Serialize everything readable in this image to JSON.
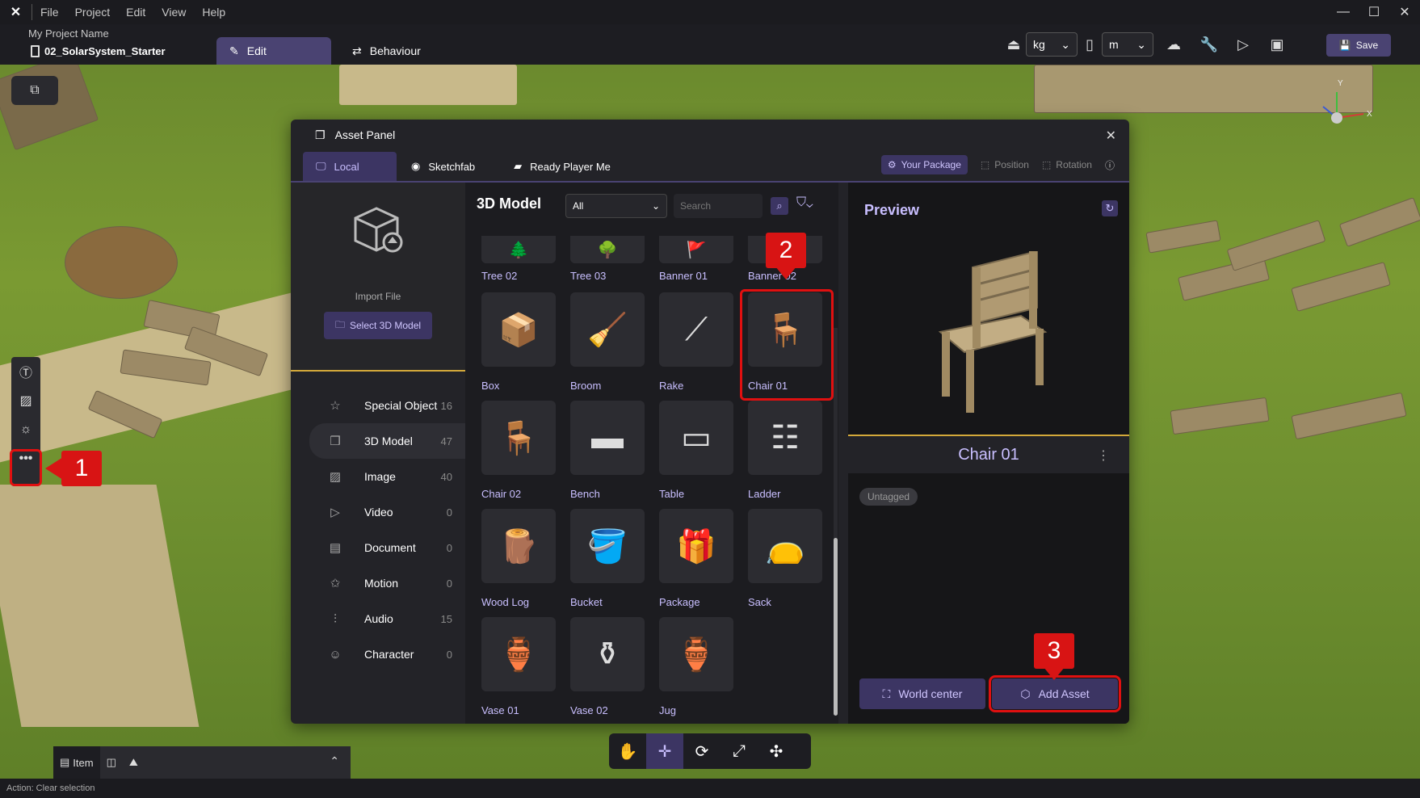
{
  "menubar": {
    "logo": "✕",
    "items": [
      "File",
      "Project",
      "Edit",
      "View",
      "Help"
    ]
  },
  "toolbar": {
    "project_name": "My Project Name",
    "scene_name": "02_SolarSystem_Starter",
    "tab_edit": "Edit",
    "tab_behaviour": "Behaviour",
    "mass_unit": "kg",
    "length_unit": "m",
    "save_label": "Save"
  },
  "asset_panel": {
    "title": "Asset Panel",
    "tabs": {
      "local": "Local",
      "sketchfab": "Sketchfab",
      "rpm": "Ready Player Me"
    },
    "right": {
      "your_package": "Your Package",
      "position": "Position",
      "rotation": "Rotation"
    },
    "import": {
      "label": "Import File",
      "button": "Select 3D Model"
    },
    "categories": [
      {
        "label": "Special Object",
        "count": "16",
        "icon": "☆"
      },
      {
        "label": "3D Model",
        "count": "47",
        "icon": "❒"
      },
      {
        "label": "Image",
        "count": "40",
        "icon": "▨"
      },
      {
        "label": "Video",
        "count": "0",
        "icon": "▷"
      },
      {
        "label": "Document",
        "count": "0",
        "icon": "▤"
      },
      {
        "label": "Motion",
        "count": "0",
        "icon": "✩"
      },
      {
        "label": "Audio",
        "count": "15",
        "icon": "⫶"
      },
      {
        "label": "Character",
        "count": "0",
        "icon": "☺"
      }
    ],
    "grid": {
      "title": "3D Model",
      "filter_value": "All",
      "search_placeholder": "Search",
      "items": [
        {
          "label": "Tree 02",
          "icon": "🌲"
        },
        {
          "label": "Tree 03",
          "icon": "🌳"
        },
        {
          "label": "Banner 01",
          "icon": "🚩"
        },
        {
          "label": "Banner 02",
          "icon": "🚩"
        },
        {
          "label": "Box",
          "icon": "📦"
        },
        {
          "label": "Broom",
          "icon": "🧹"
        },
        {
          "label": "Rake",
          "icon": "⟋"
        },
        {
          "label": "Chair 01",
          "icon": "🪑"
        },
        {
          "label": "Chair 02",
          "icon": "🪑"
        },
        {
          "label": "Bench",
          "icon": "▬"
        },
        {
          "label": "Table",
          "icon": "▭"
        },
        {
          "label": "Ladder",
          "icon": "☷"
        },
        {
          "label": "Wood Log",
          "icon": "🪵"
        },
        {
          "label": "Bucket",
          "icon": "🪣"
        },
        {
          "label": "Package",
          "icon": "🎁"
        },
        {
          "label": "Sack",
          "icon": "👝"
        },
        {
          "label": "Vase 01",
          "icon": "🏺"
        },
        {
          "label": "Vase 02",
          "icon": "⚱"
        },
        {
          "label": "Jug",
          "icon": "🏺"
        }
      ]
    },
    "preview": {
      "title": "Preview",
      "asset_name": "Chair 01",
      "tag": "Untagged",
      "world_center": "World center",
      "add_asset": "Add Asset"
    }
  },
  "annotations": [
    "1",
    "2",
    "3"
  ],
  "bottom": {
    "item_tab": "Item",
    "status": "Action: Clear selection"
  },
  "gizmo": {
    "x": "X",
    "y": "Y"
  },
  "colors": {
    "accent": "#4a4372",
    "accent_text": "#c9bfff",
    "highlight": "#e01010",
    "divider": "#d4a93a"
  }
}
